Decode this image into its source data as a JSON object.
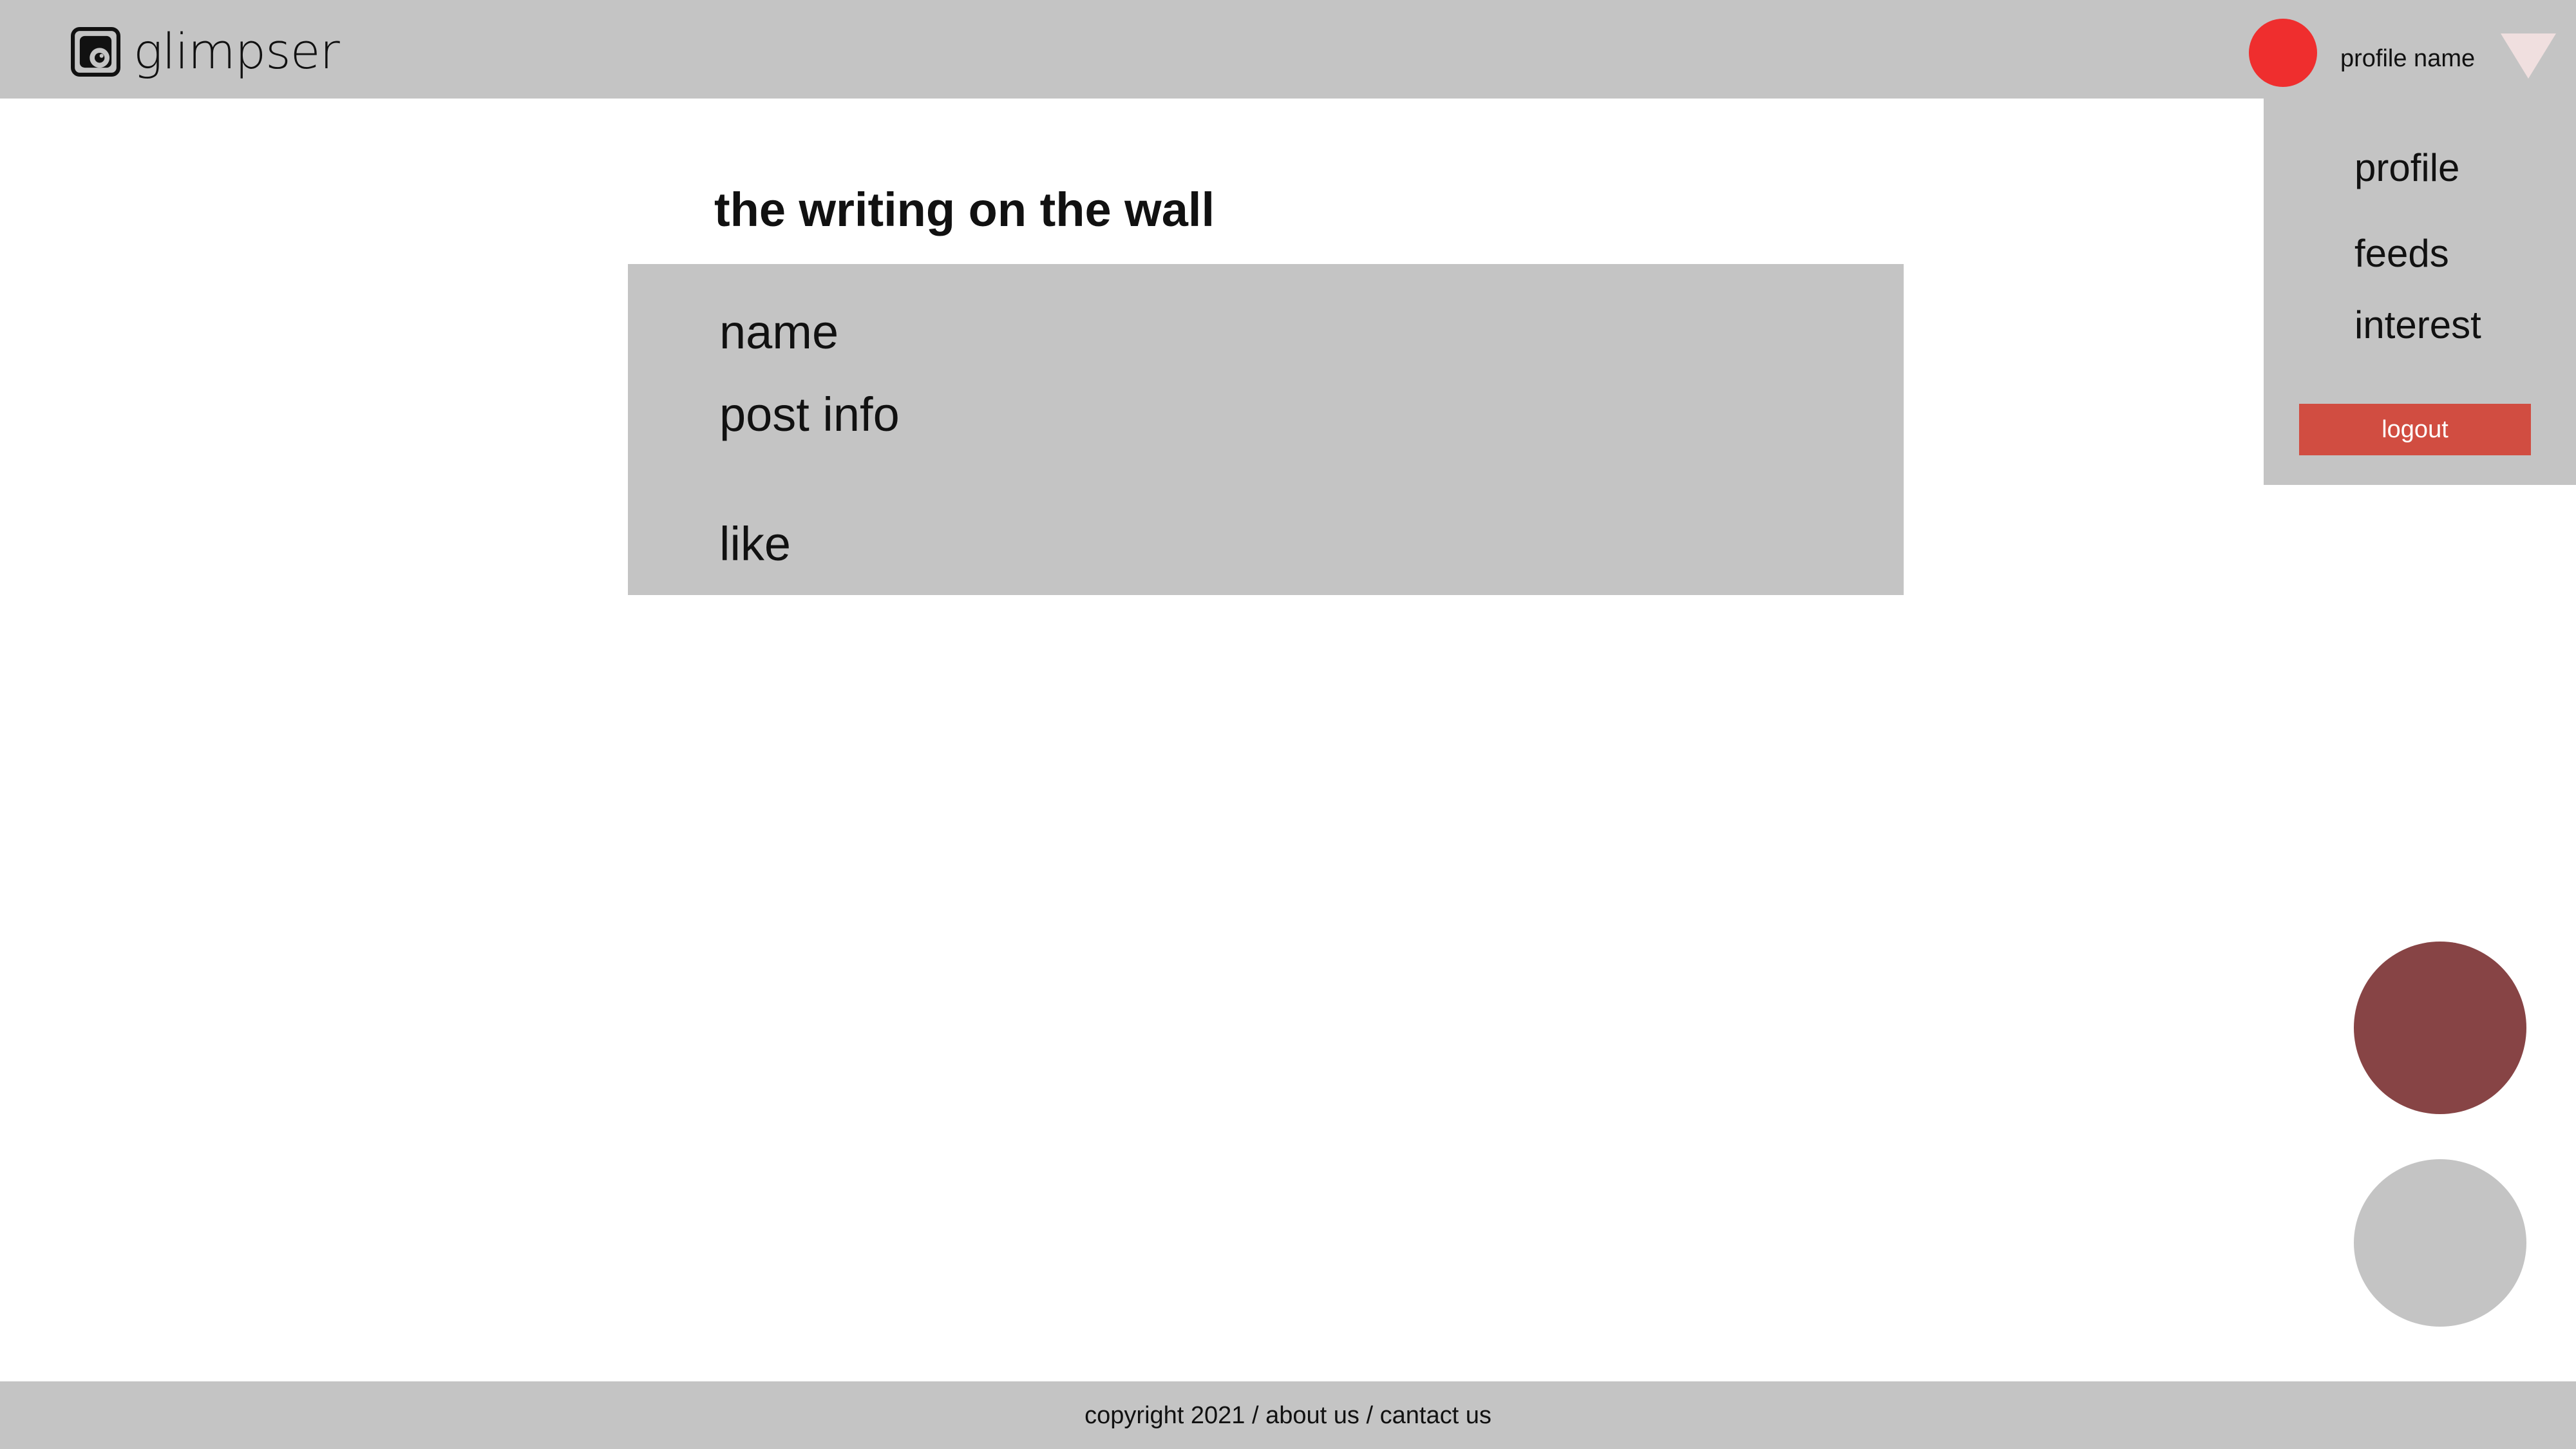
{
  "header": {
    "app_name": "glimpser",
    "logo_icon": "glimpser-logo-icon",
    "profile_name": "profile name",
    "avatar_color": "#ef2e2e",
    "dropdown_icon": "triangle-down-icon"
  },
  "menu": {
    "items": [
      {
        "label": "profile"
      },
      {
        "label": "feeds"
      },
      {
        "label": "interest"
      }
    ],
    "logout_label": "logout",
    "logout_color": "#d14d41"
  },
  "main": {
    "title": "the writing on the wall",
    "post": {
      "name": "name",
      "info": "post info",
      "like": "like"
    }
  },
  "fabs": {
    "primary_color": "#874445",
    "secondary_color": "#c4c4c4"
  },
  "footer": {
    "copyright": "copyright 2021",
    "separator": " / ",
    "about": "about us",
    "contact": "cantact us"
  }
}
